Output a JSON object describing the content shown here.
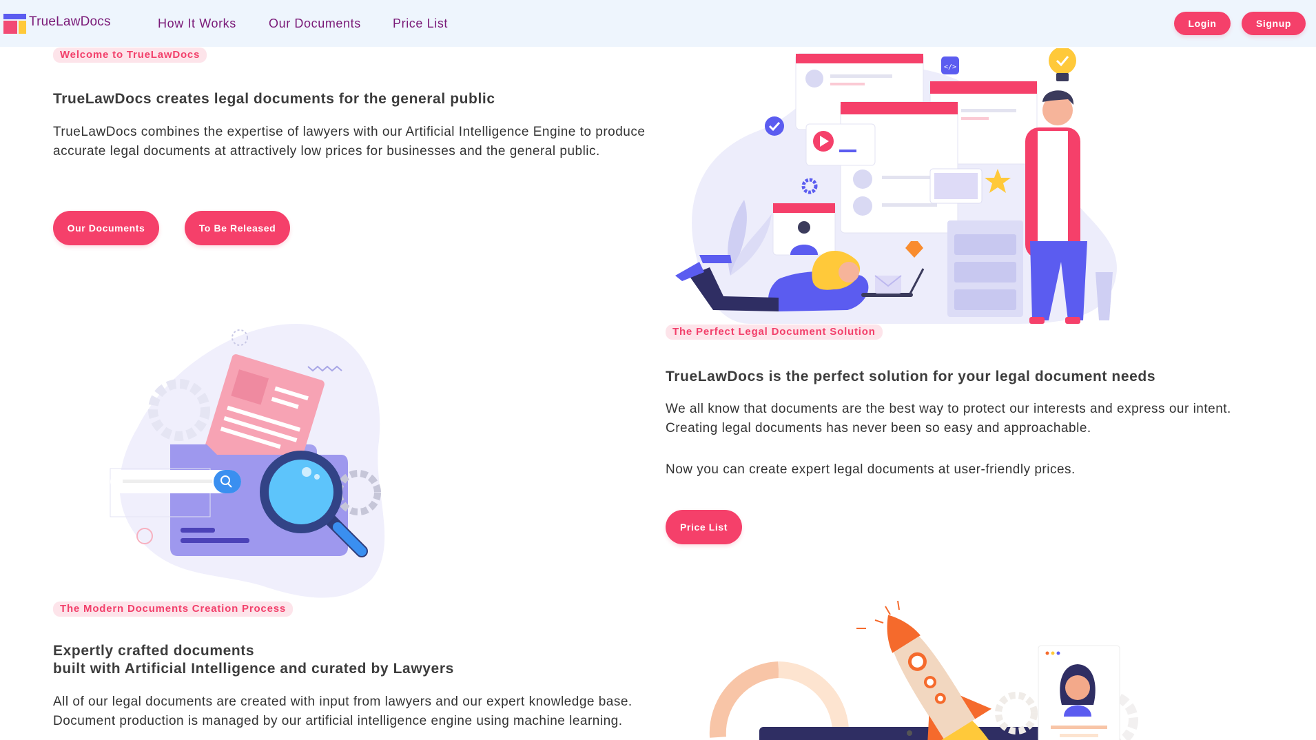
{
  "brand": {
    "name": "TrueLawDocs"
  },
  "nav": {
    "links": [
      "How It Works",
      "Our Documents",
      "Price List"
    ],
    "login_label": "Login",
    "signup_label": "Signup"
  },
  "hero": {
    "tag": "Welcome to TrueLawDocs",
    "heading": "TrueLawDocs creates legal documents for the general public",
    "body": "TrueLawDocs combines the expertise of lawyers with our Artificial Intelligence Engine to produce accurate legal documents at attractively low prices for businesses and the general public.",
    "buttons": [
      "Our Documents",
      "To Be Released"
    ]
  },
  "solution": {
    "tag": "The Perfect Legal Document Solution",
    "heading": "TrueLawDocs is the perfect solution for your legal document needs",
    "body1": "We all know that documents are the best way to protect our interests and express our intent. Creating legal documents has never been so easy and approachable.",
    "body2": "Now you can create expert legal documents at user-friendly prices.",
    "button": "Price List"
  },
  "process": {
    "tag": "The Modern Documents Creation Process",
    "heading_line1": "Expertly crafted documents",
    "heading_line2": "built with Artificial Intelligence and curated by Lawyers",
    "body": "All of our legal documents are created with input from lawyers and our expert knowledge base. Document production is managed by our artificial intelligence engine using machine learning."
  },
  "colors": {
    "accent": "#f5406a",
    "brand": "#7a1a78",
    "nav_bg": "#eef5fd",
    "tag_bg": "#fde4ea",
    "purple": "#6c63ff"
  },
  "icons": {
    "logo": "logo-blocks-icon",
    "hero_illustration": "team-documents-illustration",
    "search_illustration": "folder-search-illustration",
    "rocket_illustration": "rocket-launch-illustration"
  }
}
